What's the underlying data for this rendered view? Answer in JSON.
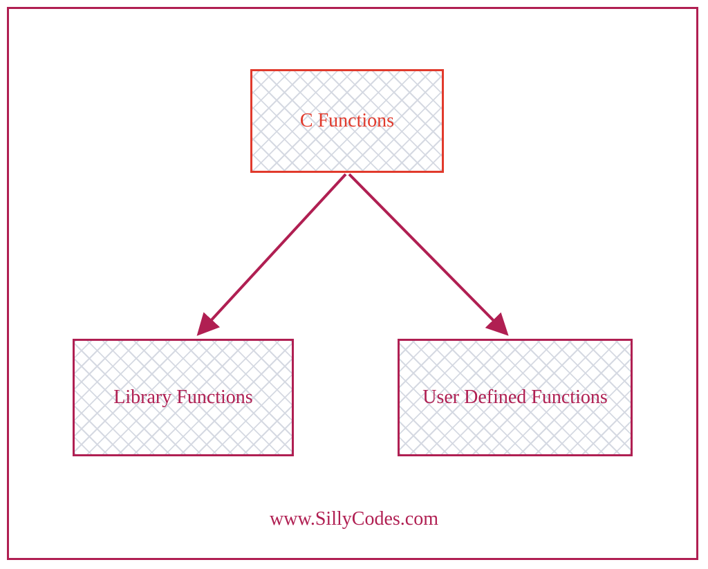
{
  "diagram": {
    "root": {
      "label": "C Functions"
    },
    "left": {
      "label": "Library Functions"
    },
    "right": {
      "label": "User Defined Functions"
    }
  },
  "footer": {
    "text": "www.SillyCodes.com"
  },
  "colors": {
    "frame": "#b01f52",
    "root_border": "#e13a2c",
    "child_border": "#b01f52",
    "hatch": "#d5d9e2"
  }
}
